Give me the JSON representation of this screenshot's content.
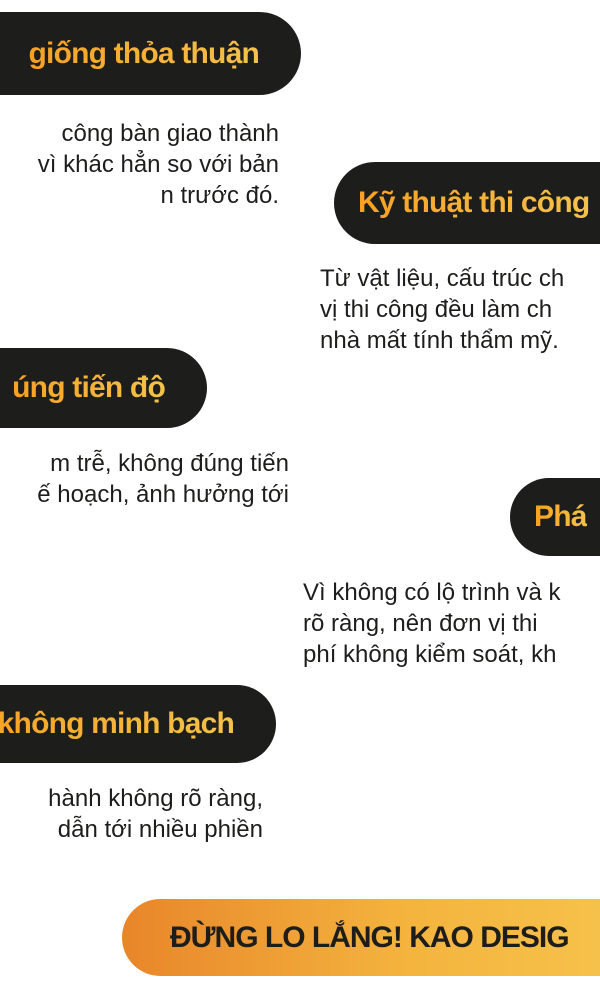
{
  "items": [
    {
      "title": "giống thỏa thuận",
      "text": "công bàn giao thành\nvì khác hẳn so với bản\nn trước đó."
    },
    {
      "title": "Kỹ thuật thi công",
      "text": "Từ vật liệu, cấu trúc ch\nvị thi công đều làm ch\nnhà mất tính thẩm mỹ."
    },
    {
      "title": "úng tiến độ",
      "text": "m trễ, không đúng tiến\nế hoạch, ảnh hưởng tới"
    },
    {
      "title": "Phá",
      "text": "Vì không có lộ trình và k\nrõ ràng, nên đơn vị thi\nphí không kiểm soát, kh"
    },
    {
      "title": "h không minh bạch",
      "text": "hành không rõ ràng,\ndẫn tới nhiều phiền"
    }
  ],
  "cta": {
    "text": "ĐỪNG LO LẮNG! KAO DESIG"
  }
}
